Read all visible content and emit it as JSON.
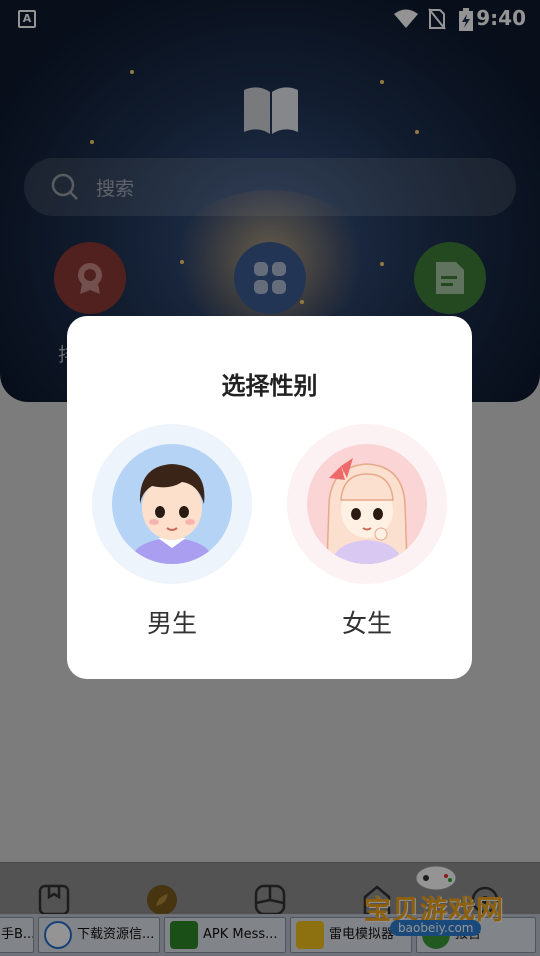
{
  "status_bar": {
    "time": "9:40",
    "notification_icon": "A"
  },
  "header": {
    "logo_icon": "book-icon"
  },
  "search": {
    "placeholder": "搜索"
  },
  "categories": [
    {
      "name": "rank",
      "label": "排",
      "color": "#8a3a34"
    },
    {
      "name": "all",
      "label": "",
      "color": "#3b5c92"
    },
    {
      "name": "finished",
      "label": "",
      "color": "#3e7e3a"
    }
  ],
  "dialog": {
    "title": "选择性别",
    "options": [
      {
        "label": "男生",
        "avatar": "boy-avatar"
      },
      {
        "label": "女生",
        "avatar": "girl-avatar"
      }
    ]
  },
  "taskbar": {
    "items": [
      {
        "label": "手B..."
      },
      {
        "label": "下载资源信..."
      },
      {
        "label": "APK Mess..."
      },
      {
        "label": "雷电模拟器"
      },
      {
        "label": "报告"
      }
    ]
  },
  "watermark": {
    "text": "宝贝游戏网",
    "url": "baobeiy.com"
  }
}
